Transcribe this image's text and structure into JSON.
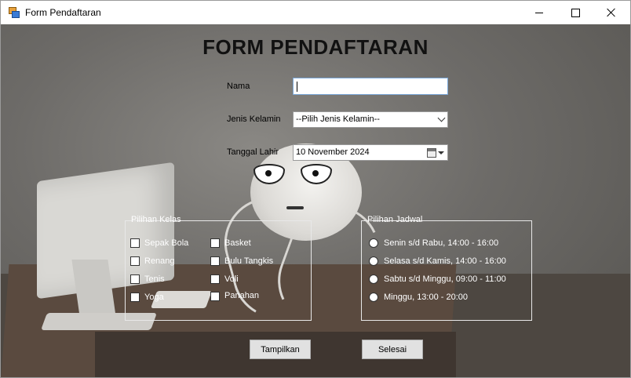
{
  "window": {
    "title": "Form Pendaftaran"
  },
  "form": {
    "heading": "FORM PENDAFTARAN",
    "nama": {
      "label": "Nama",
      "value": ""
    },
    "jenis_kelamin": {
      "label": "Jenis Kelamin",
      "value": "--Pilih Jenis Kelamin--"
    },
    "tanggal_lahir": {
      "label": "Tanggal Lahir",
      "value": "10 November 2024"
    }
  },
  "pilihan_kelas": {
    "title": "Pilihan Kelas",
    "options": [
      "Sepak Bola",
      "Renang",
      "Tenis",
      "Yoga",
      "Basket",
      "Bulu Tangkis",
      "Voli",
      "Panahan"
    ]
  },
  "pilihan_jadwal": {
    "title": "Pilihan Jadwal",
    "options": [
      "Senin s/d Rabu, 14:00 - 16:00",
      "Selasa s/d Kamis, 14:00 - 16:00",
      "Sabtu s/d Minggu, 09:00 - 11:00",
      "Minggu, 13:00 - 20:00"
    ]
  },
  "buttons": {
    "tampilkan": "Tampilkan",
    "selesai": "Selesai"
  }
}
